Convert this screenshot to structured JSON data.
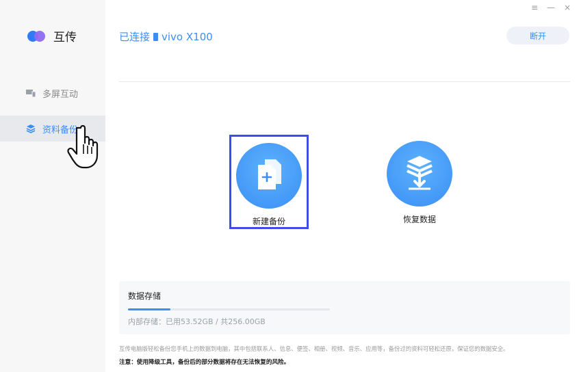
{
  "app": {
    "name": "互传"
  },
  "window_controls": {
    "menu": "≡",
    "minimize": "—",
    "close": "×"
  },
  "sidebar": {
    "items": [
      {
        "label": "多屏互动",
        "icon": "screens-icon",
        "active": false
      },
      {
        "label": "资料备份",
        "icon": "layers-icon",
        "active": true
      }
    ]
  },
  "header": {
    "connection_prefix": "已连接",
    "device_name": "vivo X100",
    "disconnect_label": "断开"
  },
  "actions": {
    "new_backup": {
      "label": "新建备份",
      "icon": "new-document-icon"
    },
    "restore": {
      "label": "恢复数据",
      "icon": "layers-download-icon"
    }
  },
  "storage": {
    "title": "数据存储",
    "text": "内部存储：已用53.52GB / 共256.00GB",
    "used_fraction": 0.209
  },
  "footnote": "互传电脑版轻松备份您手机上的数据到电脑，其中包括联系人、信息、便签、相册、视频、音乐、应用等，备份过的资料可轻松还原，保证您的数据安全。",
  "warning": "注意：使用降级工具，备份后的部分数据将存在无法恢复的风险。",
  "colors": {
    "accent": "#3a8ef6",
    "highlight_border": "#3e4de6"
  }
}
